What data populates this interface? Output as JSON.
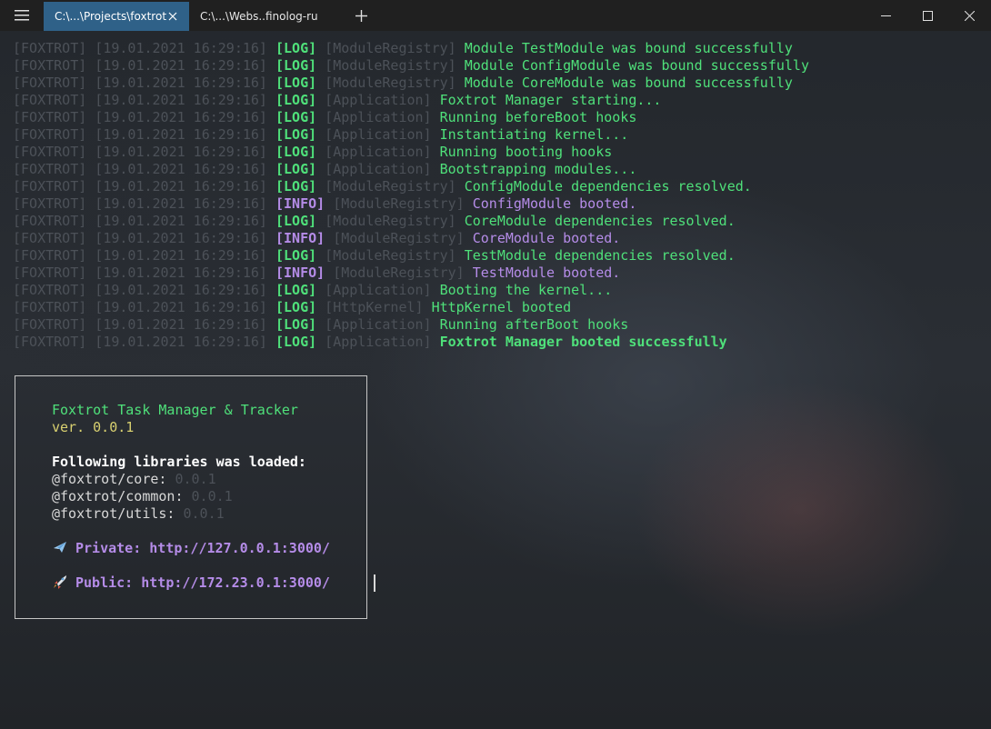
{
  "titlebar": {
    "tabs": [
      {
        "label": "C:\\...\\Projects\\foxtrot",
        "active": true
      },
      {
        "label": "C:\\...\\Webs..finolog-ru",
        "active": false
      }
    ],
    "icons": [
      "hamburger-menu-icon",
      "close-icon",
      "plus-icon",
      "minimize-icon",
      "maximize-icon",
      "close-window-icon"
    ]
  },
  "terminal": {
    "lines": [
      {
        "prefix": "[FOXTROT] [19.01.2021 16:29:16] ",
        "level": "[LOG]",
        "source": " [ModuleRegistry] ",
        "message": "Module TestModule was bound successfully"
      },
      {
        "prefix": "[FOXTROT] [19.01.2021 16:29:16] ",
        "level": "[LOG]",
        "source": " [ModuleRegistry] ",
        "message": "Module ConfigModule was bound successfully"
      },
      {
        "prefix": "[FOXTROT] [19.01.2021 16:29:16] ",
        "level": "[LOG]",
        "source": " [ModuleRegistry] ",
        "message": "Module CoreModule was bound successfully"
      },
      {
        "prefix": "[FOXTROT] [19.01.2021 16:29:16] ",
        "level": "[LOG]",
        "source": " [Application] ",
        "message": "Foxtrot Manager starting..."
      },
      {
        "prefix": "[FOXTROT] [19.01.2021 16:29:16] ",
        "level": "[LOG]",
        "source": " [Application] ",
        "message": "Running beforeBoot hooks"
      },
      {
        "prefix": "[FOXTROT] [19.01.2021 16:29:16] ",
        "level": "[LOG]",
        "source": " [Application] ",
        "message": "Instantiating kernel..."
      },
      {
        "prefix": "[FOXTROT] [19.01.2021 16:29:16] ",
        "level": "[LOG]",
        "source": " [Application] ",
        "message": "Running booting hooks"
      },
      {
        "prefix": "[FOXTROT] [19.01.2021 16:29:16] ",
        "level": "[LOG]",
        "source": " [Application] ",
        "message": "Bootstrapping modules..."
      },
      {
        "prefix": "[FOXTROT] [19.01.2021 16:29:16] ",
        "level": "[LOG]",
        "source": " [ModuleRegistry] ",
        "message": "ConfigModule dependencies resolved."
      },
      {
        "prefix": "[FOXTROT] [19.01.2021 16:29:16] ",
        "level": "[INFO]",
        "source": " [ModuleRegistry] ",
        "message": "ConfigModule booted."
      },
      {
        "prefix": "[FOXTROT] [19.01.2021 16:29:16] ",
        "level": "[LOG]",
        "source": " [ModuleRegistry] ",
        "message": "CoreModule dependencies resolved."
      },
      {
        "prefix": "[FOXTROT] [19.01.2021 16:29:16] ",
        "level": "[INFO]",
        "source": " [ModuleRegistry] ",
        "message": "CoreModule booted."
      },
      {
        "prefix": "[FOXTROT] [19.01.2021 16:29:16] ",
        "level": "[LOG]",
        "source": " [ModuleRegistry] ",
        "message": "TestModule dependencies resolved."
      },
      {
        "prefix": "[FOXTROT] [19.01.2021 16:29:16] ",
        "level": "[INFO]",
        "source": " [ModuleRegistry] ",
        "message": "TestModule booted."
      },
      {
        "prefix": "[FOXTROT] [19.01.2021 16:29:16] ",
        "level": "[LOG]",
        "source": " [Application] ",
        "message": "Booting the kernel..."
      },
      {
        "prefix": "[FOXTROT] [19.01.2021 16:29:16] ",
        "level": "[LOG]",
        "source": " [HttpKernel] ",
        "message": "HttpKernel booted"
      },
      {
        "prefix": "[FOXTROT] [19.01.2021 16:29:16] ",
        "level": "[LOG]",
        "source": " [Application] ",
        "message": "Running afterBoot hooks"
      },
      {
        "prefix": "[FOXTROT] [19.01.2021 16:29:16] ",
        "level": "[LOG]",
        "source": " [Application] ",
        "message": "Foxtrot Manager booted successfully",
        "bold": true
      }
    ],
    "banner": {
      "title": "Foxtrot Task Manager & Tracker",
      "version": "ver. 0.0.1",
      "libraries_heading": "Following libraries was loaded:",
      "libraries": [
        {
          "name": "@foxtrot/core:",
          "version": "0.0.1"
        },
        {
          "name": "@foxtrot/common:",
          "version": "0.0.1"
        },
        {
          "name": "@foxtrot/utils:",
          "version": "0.0.1"
        }
      ],
      "private_label": "Private: http://127.0.0.1:3000/",
      "public_label": "Public: http://172.23.0.1:3000/",
      "private_icon": "airplane-icon",
      "public_icon": "rocket-icon"
    }
  },
  "colors": {
    "active_tab": "#2f6188",
    "log_green": "#4fe07a",
    "info_purple": "#b58ce8",
    "dim_grey": "#4c5158",
    "version_yellow": "#d8d070"
  }
}
